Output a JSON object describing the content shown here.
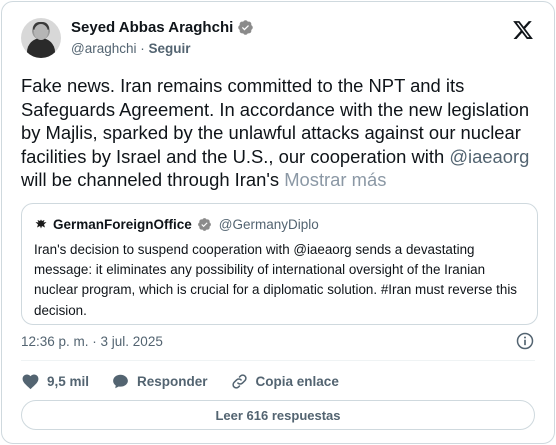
{
  "author": {
    "display_name": "Seyed Abbas Araghchi",
    "handle": "@araghchi",
    "separator": "·",
    "follow_label": "Seguir",
    "avatar_icon": "profile-photo",
    "verified_icon": "verified-badge-icon"
  },
  "tweet": {
    "text_before_mention": "Fake news. Iran remains committed to the NPT and its Safeguards Agreement. In accordance with the new legislation by Majlis, sparked by the unlawful attacks against our nuclear facilities by Israel and the U.S., our cooperation with ",
    "mention": "@iaeaorg",
    "text_after_mention": " will be channeled through Iran's ",
    "show_more": "Mostrar más"
  },
  "quote": {
    "display_name": "GermanForeignOffice",
    "handle": "@GermanyDiplo",
    "text": "Iran's decision to suspend cooperation with @iaeaorg sends a devastating message: it eliminates any possibility of international oversight of the Iranian nuclear program, which is crucial for a diplomatic solution. #Iran must reverse this decision."
  },
  "meta": {
    "timestamp": "12:36 p. m. · 3 jul. 2025"
  },
  "actions": {
    "like_count": "9,5 mil",
    "reply_label": "Responder",
    "copy_link_label": "Copia enlace"
  },
  "footer": {
    "read_replies_label": "Leer 616 respuestas"
  },
  "colors": {
    "text_primary": "#0f1419",
    "text_secondary": "#536471",
    "border": "#cfd9de",
    "verified": "#8b8b8b"
  }
}
